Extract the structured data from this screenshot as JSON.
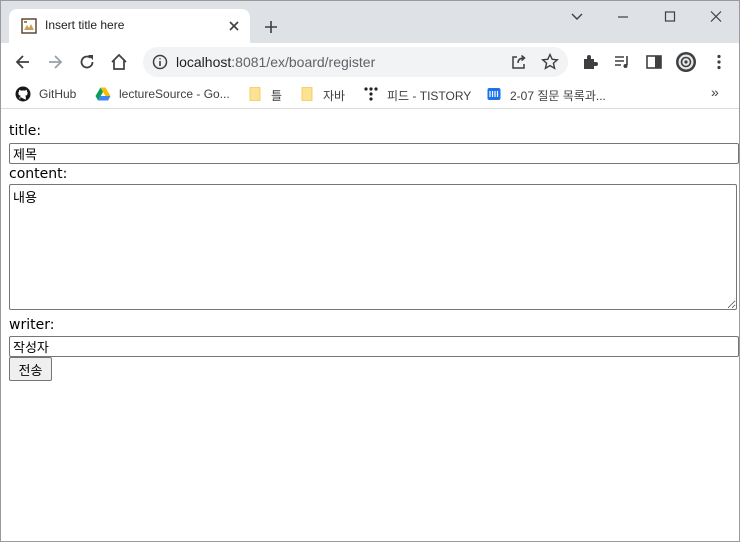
{
  "browser": {
    "tab_title": "Insert title here",
    "url_host": "localhost",
    "url_path": ":8081/ex/board/register",
    "bookmarks": [
      {
        "label": "GitHub",
        "icon": "github-icon"
      },
      {
        "label": "lectureSource - Go...",
        "icon": "google-drive-icon"
      },
      {
        "label": "틀",
        "icon": "folder-icon"
      },
      {
        "label": "자바",
        "icon": "folder-icon"
      },
      {
        "label": "피드 - TISTORY",
        "icon": "tistory-icon"
      },
      {
        "label": "2-07 질문 목록과...",
        "icon": "wikidocs-icon"
      }
    ],
    "more_bookmarks": "»"
  },
  "form": {
    "title_label": "title:",
    "title_value": "제목",
    "content_label": "content:",
    "content_value": "내용",
    "writer_label": "writer:",
    "writer_value": "작성자",
    "submit_label": "전송"
  }
}
